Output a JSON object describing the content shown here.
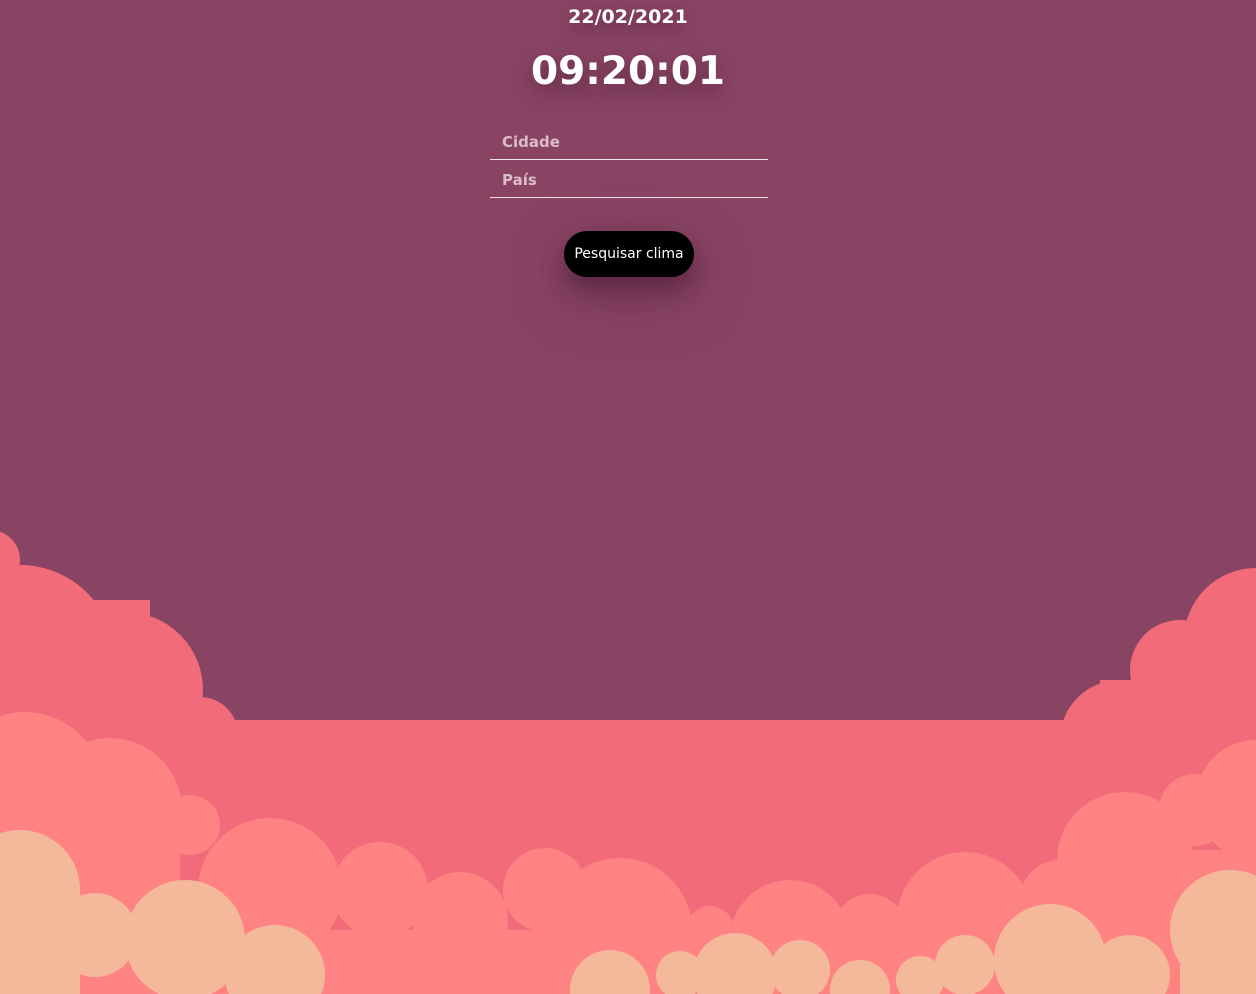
{
  "header": {
    "date": "22/02/2021",
    "time": "09:20:01"
  },
  "form": {
    "city_placeholder": "Cidade",
    "country_placeholder": "País",
    "city_value": "",
    "country_value": "",
    "search_label": "Pesquisar clima"
  },
  "colors": {
    "background": "#894464",
    "cloud_back": "#f26b7a",
    "cloud_mid": "#ff8383",
    "cloud_front": "#f4b99a",
    "button": "#000000",
    "text": "#ffffff"
  }
}
